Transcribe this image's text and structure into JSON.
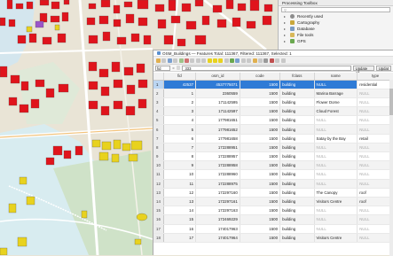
{
  "toolbox": {
    "title": "Processing Toolbox",
    "items": [
      {
        "label": "Recently used",
        "icon": "clock-icon",
        "color": "#8c8c8c"
      },
      {
        "label": "Cartography",
        "icon": "cartography-icon",
        "color": "#c9a73a"
      },
      {
        "label": "Database",
        "icon": "database-icon",
        "color": "#7a9bc2"
      },
      {
        "label": "File tools",
        "icon": "folder-icon",
        "color": "#d8b85a"
      },
      {
        "label": "GPS",
        "icon": "gps-icon",
        "color": "#6aa84f"
      }
    ]
  },
  "attribute_table": {
    "title": "OSM_Buildings — Features Total: 111367, Filtered: 111367, Selected: 1",
    "field_select": "fid",
    "expression": "333",
    "update_all_label": "Update All",
    "update_selected_label": "Updat",
    "columns": [
      "",
      "fid",
      "osm_id",
      "code",
      "fclass",
      "name",
      "type"
    ],
    "rows": [
      [
        "1",
        "42537",
        "4537775071",
        "1500",
        "building",
        "NULL",
        "residential"
      ],
      [
        "2",
        "1",
        "2360559",
        "1500",
        "building",
        "Marina Barrage",
        "NULL"
      ],
      [
        "3",
        "2",
        "171142595",
        "1500",
        "building",
        "Flower Dome",
        "NULL"
      ],
      [
        "4",
        "3",
        "171142597",
        "1500",
        "building",
        "Cloud Forest",
        "NULL"
      ],
      [
        "5",
        "4",
        "177981651",
        "1500",
        "building",
        "NULL",
        "NULL"
      ],
      [
        "6",
        "5",
        "177981652",
        "1500",
        "building",
        "NULL",
        "NULL"
      ],
      [
        "7",
        "6",
        "177981658",
        "1500",
        "building",
        "Satay by the Bay",
        "retail"
      ],
      [
        "8",
        "7",
        "172288951",
        "1500",
        "building",
        "NULL",
        "NULL"
      ],
      [
        "9",
        "8",
        "172288957",
        "1500",
        "building",
        "NULL",
        "NULL"
      ],
      [
        "10",
        "9",
        "172288958",
        "1500",
        "building",
        "NULL",
        "NULL"
      ],
      [
        "11",
        "10",
        "172288960",
        "1500",
        "building",
        "NULL",
        "NULL"
      ],
      [
        "12",
        "11",
        "172288975",
        "1500",
        "building",
        "NULL",
        "NULL"
      ],
      [
        "13",
        "12",
        "172297160",
        "1500",
        "building",
        "The Canopy",
        "roof"
      ],
      [
        "14",
        "13",
        "172297161",
        "1500",
        "building",
        "Visitors Centre",
        "roof"
      ],
      [
        "15",
        "14",
        "172297163",
        "1500",
        "building",
        "NULL",
        "NULL"
      ],
      [
        "16",
        "15",
        "172469229",
        "1500",
        "building",
        "NULL",
        "NULL"
      ],
      [
        "17",
        "16",
        "174017963",
        "1500",
        "building",
        "NULL",
        "NULL"
      ],
      [
        "18",
        "17",
        "174017964",
        "1500",
        "building",
        "Visitors Centre",
        "NULL"
      ]
    ],
    "selected_row": 0
  },
  "colors": {
    "building_fill": "#e0141c",
    "building_yellow": "#e8d21e",
    "map_background": "#e9e4d6",
    "selection_blue": "#2f7bd6",
    "purple_highlight": "#9a55c9"
  }
}
